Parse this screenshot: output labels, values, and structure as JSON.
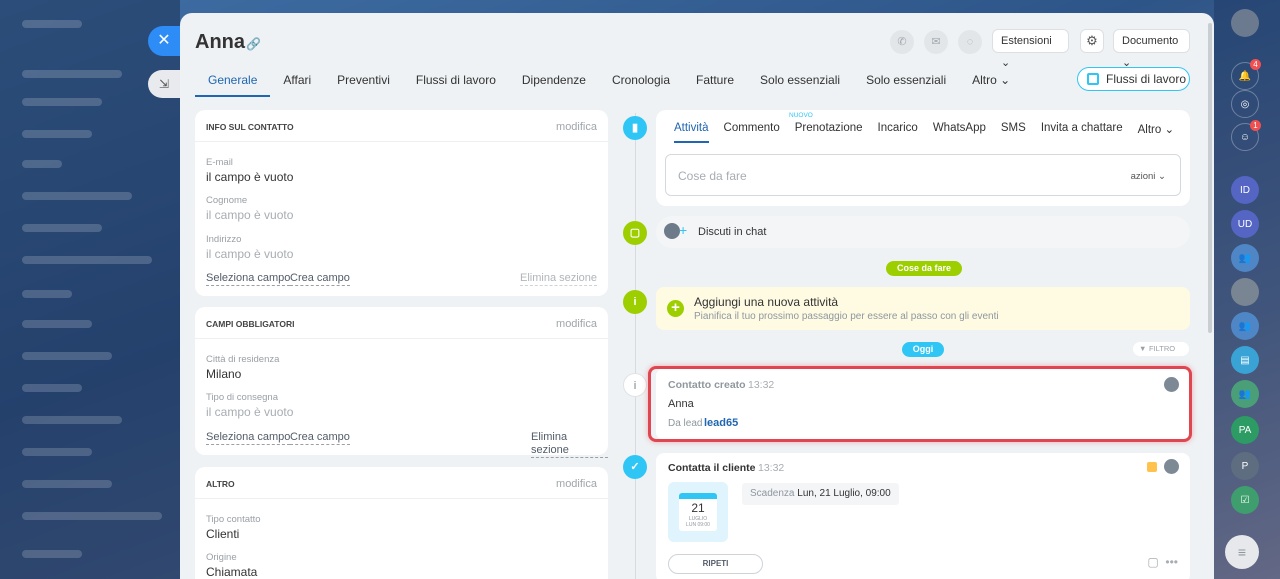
{
  "entity": {
    "title": "Anna"
  },
  "header": {
    "extensions_label": "Estensioni",
    "document_label": "Documento"
  },
  "tabs": [
    {
      "label": "Generale"
    },
    {
      "label": "Affari"
    },
    {
      "label": "Preventivi"
    },
    {
      "label": "Flussi di lavoro"
    },
    {
      "label": "Dipendenze"
    },
    {
      "label": "Cronologia"
    },
    {
      "label": "Fatture"
    },
    {
      "label": "Solo essenziali"
    },
    {
      "label": "Solo essenziali"
    },
    {
      "label": "Altro ⌄"
    }
  ],
  "workflow_button": "Flussi di lavoro",
  "contact_info": {
    "heading": "INFO SUL CONTATTO",
    "edit": "modifica",
    "email_label": "E-mail",
    "email_value": "il campo è vuoto",
    "surname_label": "Cognome",
    "surname_value": "il campo è vuoto",
    "address_label": "Indirizzo",
    "address_value": "il campo è vuoto",
    "select_field": "Seleziona campo",
    "create_field": "Crea campo",
    "delete_section": "Elimina sezione"
  },
  "required_fields": {
    "heading": "CAMPI OBBLIGATORI",
    "edit": "modifica",
    "city_label": "Città di residenza",
    "city_value": "Milano",
    "delivery_label": "Tipo di consegna",
    "delivery_value": "il campo è vuoto",
    "select_field": "Seleziona campo",
    "create_field": "Crea campo",
    "delete_section": "Elimina sezione"
  },
  "other": {
    "heading": "ALTRO",
    "edit": "modifica",
    "type_label": "Tipo contatto",
    "type_value": "Clienti",
    "source_label": "Origine",
    "source_value": "Chiamata"
  },
  "editor": {
    "tabs": [
      "Attività",
      "Commento",
      "Prenotazione",
      "Incarico",
      "WhatsApp",
      "SMS",
      "Invita a chattare",
      "Altro ⌄"
    ],
    "new_badge": "NUOVO",
    "placeholder": "Cose da fare",
    "actions": "azioni ⌄"
  },
  "chat": {
    "label": "Discuti in chat"
  },
  "todo_pill": "Cose da fare",
  "add_activity": {
    "title": "Aggiungi una nuova attività",
    "subtitle": "Pianifica il tuo prossimo passaggio per essere al passo con gli eventi"
  },
  "today_pill": "Oggi",
  "filter_label": "FILTRO",
  "events": [
    {
      "title": "Contatto creato",
      "time": "13:32",
      "name": "Anna",
      "from_prefix": "Da lead",
      "from_link": "lead65"
    },
    {
      "title": "Contatta il cliente",
      "time": "13:32",
      "cal_day": "21",
      "cal_month": "LUGLIO",
      "cal_sub": "LUN 09:00",
      "deadline_label": "Scadenza",
      "deadline_value": "Lun, 21 Luglio, 09:00",
      "repeat": "RIPETI"
    }
  ],
  "rail": {
    "notifications_count": "4",
    "chat_count": "1",
    "users": [
      "ID",
      "UD",
      "PA",
      "P"
    ]
  },
  "colors": {
    "accent": "#2066b0",
    "timeline_green": "#9dcf00",
    "timeline_blue": "#2fc6f6",
    "today_pill": "#2fc6f6",
    "highlight": "#e04550"
  }
}
